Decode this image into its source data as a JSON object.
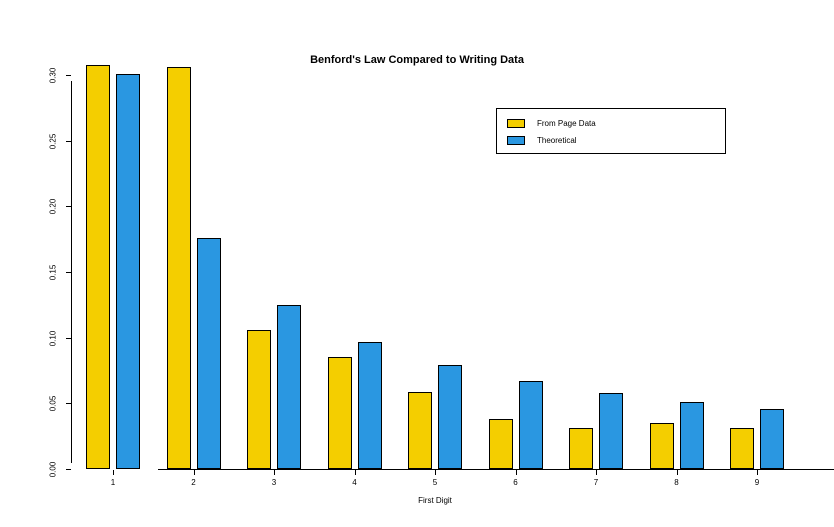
{
  "chart_data": {
    "type": "bar",
    "title": "Benford's Law Compared to Writing Data",
    "xlabel": "First Digit",
    "ylabel": "",
    "ylim": [
      0.0,
      0.3
    ],
    "y_ticks": [
      "0.00",
      "0.05",
      "0.10",
      "0.15",
      "0.20",
      "0.25",
      "0.30"
    ],
    "categories": [
      "1",
      "2",
      "3",
      "4",
      "5",
      "6",
      "7",
      "8",
      "9"
    ],
    "series": [
      {
        "name": "From Page Data",
        "color": "#f4ce00",
        "values": [
          0.308,
          0.306,
          0.106,
          0.085,
          0.059,
          0.038,
          0.031,
          0.035,
          0.031
        ]
      },
      {
        "name": "Theoretical",
        "color": "#2a97e1",
        "values": [
          0.301,
          0.176,
          0.125,
          0.097,
          0.079,
          0.067,
          0.058,
          0.051,
          0.046
        ]
      }
    ],
    "legend_position": "top-right"
  }
}
